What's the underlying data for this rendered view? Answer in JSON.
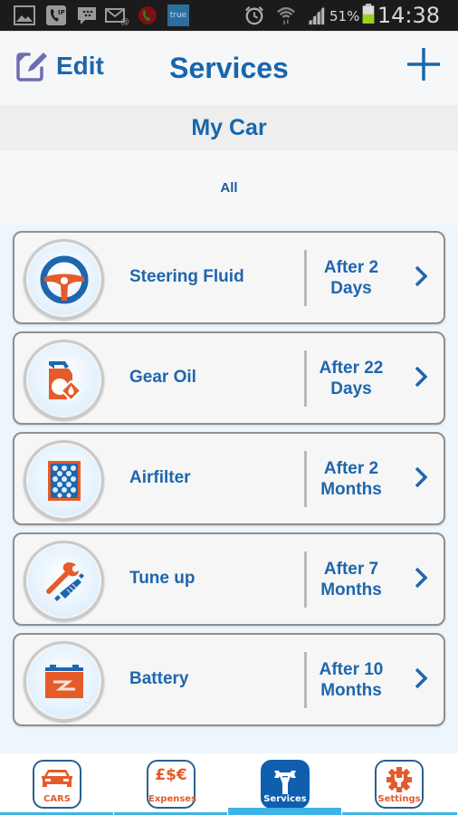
{
  "status_bar": {
    "time": "14:38",
    "battery_percent": "51%",
    "battery_level": 0.51,
    "left_icons": [
      "gallery-icon",
      "voip-call-icon",
      "bbm-icon",
      "email-icon",
      "missed-call-icon",
      "true-app-icon"
    ],
    "true_label": "true",
    "right_icons": [
      "alarm-icon",
      "wifi-icon",
      "signal-icon",
      "battery-icon"
    ]
  },
  "header": {
    "edit_label": "Edit",
    "title": "Services",
    "add_icon": "plus-icon"
  },
  "car_name": "My Car",
  "filter_label": "All",
  "services": [
    {
      "name": "Steering Fluid",
      "due_line1": "After 2",
      "due_line2": "Days",
      "icon": "steering-wheel-icon"
    },
    {
      "name": "Gear Oil",
      "due_line1": "After 22",
      "due_line2": "Days",
      "icon": "oil-can-icon"
    },
    {
      "name": "Airfilter",
      "due_line1": "After 2",
      "due_line2": "Months",
      "icon": "air-filter-icon"
    },
    {
      "name": "Tune up",
      "due_line1": "After 7",
      "due_line2": "Months",
      "icon": "wrench-spark-plug-icon"
    },
    {
      "name": "Battery",
      "due_line1": "After 10",
      "due_line2": "Months",
      "icon": "battery-icon"
    }
  ],
  "tabs": [
    {
      "label": "CARS",
      "icon": "car-icon",
      "active": false
    },
    {
      "label": "Expenses",
      "icon": "currency-icon",
      "symbol": "£$€",
      "active": false
    },
    {
      "label": "Services",
      "icon": "mechanic-icon",
      "active": true
    },
    {
      "label": "Settings",
      "icon": "gear-wrench-icon",
      "active": false
    }
  ],
  "colors": {
    "primary_blue": "#1766ae",
    "accent_orange": "#e55b2a",
    "tab_underline": "#3cb4e6",
    "status_bar_bg": "#1b1b1b"
  }
}
